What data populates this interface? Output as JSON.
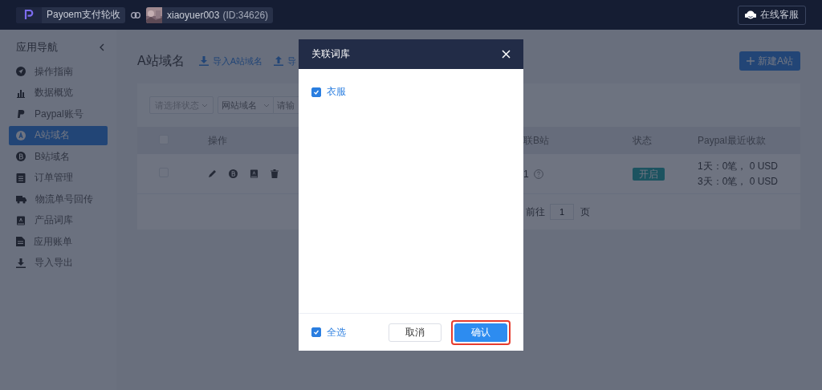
{
  "topbar": {
    "app_name": "Payoem支付轮收",
    "account": "xiaoyuer003",
    "account_id": "(ID:34626)",
    "support_button": "在线客服"
  },
  "sidebar": {
    "title": "应用导航",
    "items": [
      {
        "label": "操作指南",
        "kind": "guide",
        "selected": false
      },
      {
        "label": "数据概览",
        "kind": "chart",
        "selected": false
      },
      {
        "label": "Paypal账号",
        "kind": "paypal",
        "selected": false
      },
      {
        "label": "A站域名",
        "kind": "a",
        "selected": true
      },
      {
        "label": "B站域名",
        "kind": "b",
        "selected": false
      },
      {
        "label": "订单管理",
        "kind": "clipboard",
        "selected": false
      },
      {
        "label": "物流单号回传",
        "kind": "truck",
        "selected": false
      },
      {
        "label": "产品词库",
        "kind": "book",
        "selected": false
      },
      {
        "label": "应用账单",
        "kind": "doc",
        "selected": false
      },
      {
        "label": "导入导出",
        "kind": "download",
        "selected": false
      }
    ]
  },
  "page": {
    "title": "A站域名",
    "actions": [
      {
        "label": "导入A站域名",
        "kind": "import"
      },
      {
        "label": "导",
        "kind": "export"
      }
    ],
    "new_button": "新建A站",
    "filters": {
      "status_placeholder": "请选择状态",
      "field_select": "网站域名",
      "search_placeholder": "请输"
    },
    "table": {
      "header_checked": false,
      "columns": [
        "操作",
        "联B站",
        "状态",
        "Paypal最近收款"
      ],
      "rows": [
        {
          "checked": false,
          "linked_b": "1",
          "status": "开启",
          "status_on": true,
          "payments": [
            "1天：0笔， 0 USD",
            "3天：0笔， 0 USD"
          ]
        }
      ]
    },
    "pagination": {
      "goto": "前往",
      "page": "1",
      "suffix": "页"
    }
  },
  "modal": {
    "title": "关联词库",
    "options": [
      {
        "label": "衣服",
        "checked": true
      }
    ],
    "select_all": {
      "label": "全选",
      "checked": true
    },
    "buttons": [
      {
        "label": "取消",
        "kind": "default",
        "highlighted": false
      },
      {
        "label": "确认",
        "kind": "primary",
        "highlighted": true
      }
    ]
  }
}
